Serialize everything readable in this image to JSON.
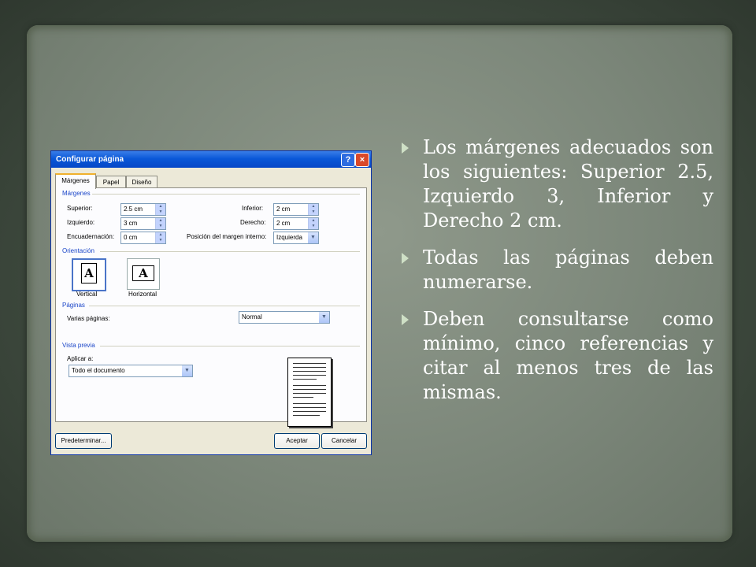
{
  "dialog": {
    "title": "Configurar página",
    "help_label": "?",
    "close_label": "×",
    "tabs": [
      {
        "label": "Márgenes",
        "active": true
      },
      {
        "label": "Papel",
        "active": false
      },
      {
        "label": "Diseño",
        "active": false
      }
    ],
    "margins": {
      "group_label": "Márgenes",
      "superior_label": "Superior:",
      "superior_value": "2.5 cm",
      "izquierdo_label": "Izquierdo:",
      "izquierdo_value": "3 cm",
      "encuadernacion_label": "Encuadernación:",
      "encuadernacion_value": "0 cm",
      "inferior_label": "Inferior:",
      "inferior_value": "2 cm",
      "derecho_label": "Derecho:",
      "derecho_value": "2 cm",
      "posicion_label": "Posición del margen interno:",
      "posicion_value": "Izquierda"
    },
    "orientation": {
      "group_label": "Orientación",
      "vertical_label": "Vertical",
      "horizontal_label": "Horizontal",
      "page_glyph": "A"
    },
    "pages": {
      "group_label": "Páginas",
      "multiple_label": "Varias páginas:",
      "multiple_value": "Normal"
    },
    "preview": {
      "group_label": "Vista previa",
      "apply_label": "Aplicar a:",
      "apply_value": "Todo el documento"
    },
    "buttons": {
      "default_label": "Predeterminar...",
      "ok_label": "Aceptar",
      "cancel_label": "Cancelar"
    },
    "colors": {
      "titlebar": "#0a58d8",
      "group_label": "#1a45c8",
      "close_button": "#d9492a"
    }
  },
  "bullets": [
    "Los márgenes adecuados son los siguientes: Superior 2.5, Izquierdo 3, Inferior y Derecho 2 cm.",
    "Todas las páginas deben numerarse.",
    "Deben consultarse como mínimo, cinco referencias y citar al menos tres de las mismas."
  ]
}
